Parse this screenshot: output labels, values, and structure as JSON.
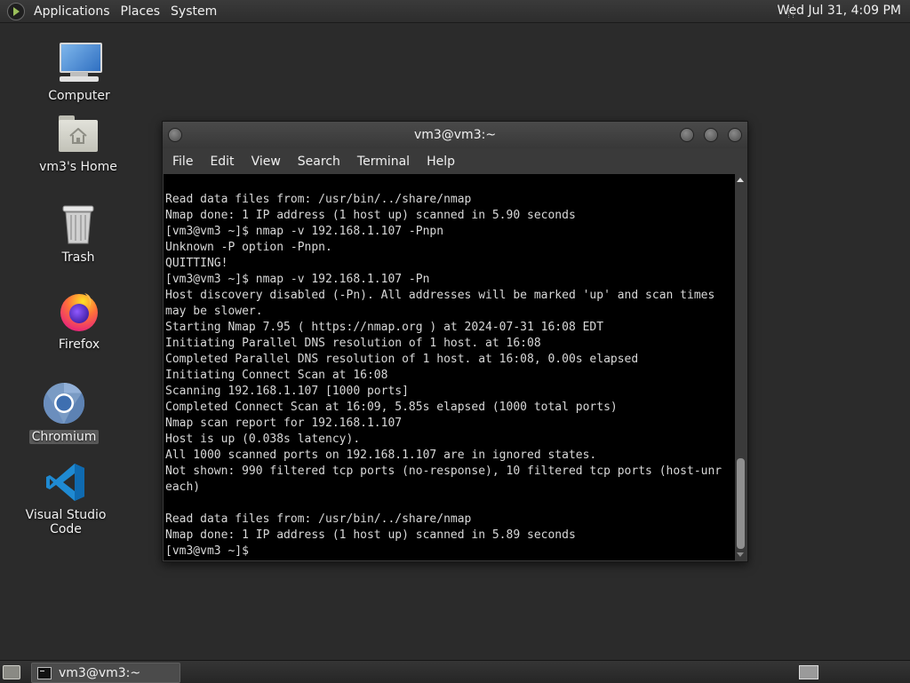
{
  "top_panel": {
    "menus": [
      "Applications",
      "Places",
      "System"
    ],
    "clock": "Wed Jul 31,  4:09 PM"
  },
  "desktop_icons": [
    {
      "label": "Computer",
      "icon": "computer-icon"
    },
    {
      "label": "vm3's Home",
      "icon": "home-folder-icon"
    },
    {
      "label": "Trash",
      "icon": "trash-icon"
    },
    {
      "label": "Firefox",
      "icon": "firefox-icon"
    },
    {
      "label": "Chromium",
      "icon": "chromium-icon",
      "selected": true
    },
    {
      "label": "Visual Studio Code",
      "icon": "vscode-icon"
    }
  ],
  "terminal": {
    "title": "vm3@vm3:~",
    "menu": [
      "File",
      "Edit",
      "View",
      "Search",
      "Terminal",
      "Help"
    ],
    "lines": [
      "Read data files from: /usr/bin/../share/nmap",
      "Nmap done: 1 IP address (1 host up) scanned in 5.90 seconds",
      "[vm3@vm3 ~]$ nmap -v 192.168.1.107 -Pnpn",
      "Unknown -P option -Pnpn.",
      "QUITTING!",
      "[vm3@vm3 ~]$ nmap -v 192.168.1.107 -Pn",
      "Host discovery disabled (-Pn). All addresses will be marked 'up' and scan times",
      "may be slower.",
      "Starting Nmap 7.95 ( https://nmap.org ) at 2024-07-31 16:08 EDT",
      "Initiating Parallel DNS resolution of 1 host. at 16:08",
      "Completed Parallel DNS resolution of 1 host. at 16:08, 0.00s elapsed",
      "Initiating Connect Scan at 16:08",
      "Scanning 192.168.1.107 [1000 ports]",
      "Completed Connect Scan at 16:09, 5.85s elapsed (1000 total ports)",
      "Nmap scan report for 192.168.1.107",
      "Host is up (0.038s latency).",
      "All 1000 scanned ports on 192.168.1.107 are in ignored states.",
      "Not shown: 990 filtered tcp ports (no-response), 10 filtered tcp ports (host-unr",
      "each)",
      "",
      "Read data files from: /usr/bin/../share/nmap",
      "Nmap done: 1 IP address (1 host up) scanned in 5.89 seconds",
      "[vm3@vm3 ~]$ "
    ]
  },
  "taskbar": {
    "task_label": "vm3@vm3:~"
  }
}
